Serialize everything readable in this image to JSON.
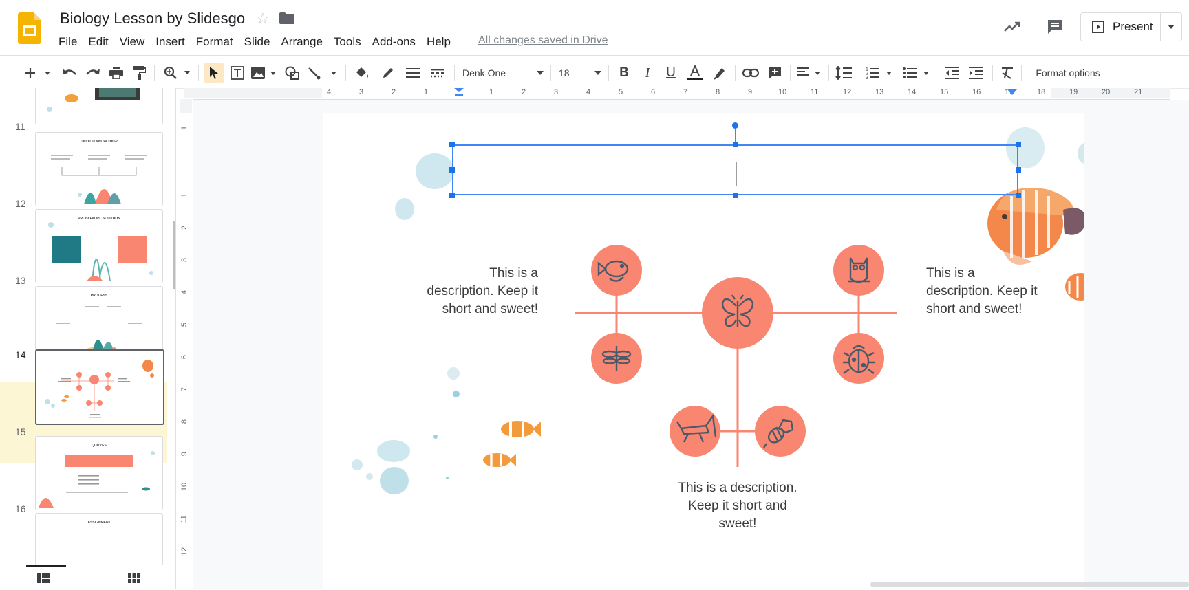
{
  "app": {
    "title": "Biology Lesson by Slidesgo",
    "save_status": "All changes saved in Drive",
    "menu": [
      "File",
      "Edit",
      "View",
      "Insert",
      "Format",
      "Slide",
      "Arrange",
      "Tools",
      "Add-ons",
      "Help"
    ],
    "present_label": "Present",
    "colors": {
      "accent": "#1a73e8",
      "logo": "#f4b400",
      "shape": "#f98670",
      "line": "#f98670",
      "selected_slide_bg": "#fdf6d5"
    }
  },
  "toolbar": {
    "font": "Denk One",
    "font_size": "18",
    "format_options": "Format options",
    "icons": [
      "new-slide-icon",
      "undo-icon",
      "redo-icon",
      "print-icon",
      "paint-format-icon",
      "zoom-icon",
      "select-icon",
      "text-box-icon",
      "image-icon",
      "shape-icon",
      "line-icon",
      "fill-color-icon",
      "border-color-icon",
      "border-weight-icon",
      "border-dash-icon",
      "bold-icon",
      "italic-icon",
      "underline-icon",
      "text-color-icon",
      "highlight-icon",
      "link-icon",
      "comment-icon",
      "align-icon",
      "line-spacing-icon",
      "numbered-list-icon",
      "bulleted-list-icon",
      "decrease-indent-icon",
      "increase-indent-icon",
      "clear-formatting-icon"
    ]
  },
  "filmstrip": {
    "slides": [
      {
        "number": "11",
        "title": "DID YOU KNOW THIS?"
      },
      {
        "number": "12",
        "title": "PROBLEM VS. SOLUTION"
      },
      {
        "number": "13",
        "title": "PROCESS"
      },
      {
        "number": "14",
        "title": ""
      },
      {
        "number": "15",
        "title": "QUIZZES"
      },
      {
        "number": "16",
        "title": "ASSIGNMENT"
      }
    ],
    "selected": "14"
  },
  "rulers": {
    "horizontal": [
      "4",
      "3",
      "2",
      "1",
      "1",
      "2",
      "3",
      "4",
      "5",
      "6",
      "7",
      "8",
      "9",
      "10",
      "11",
      "12",
      "13",
      "14",
      "15",
      "16",
      "17",
      "18",
      "19",
      "20",
      "21"
    ],
    "vertical": [
      "1",
      "1",
      "2",
      "3",
      "4",
      "5",
      "6",
      "7",
      "8",
      "9",
      "10",
      "11",
      "12"
    ]
  },
  "slide": {
    "descriptions": [
      "This is a description. Keep it short and sweet!",
      "This is a description. Keep it short and sweet!",
      "This is a description. Keep it short and sweet!"
    ],
    "nodes": [
      "fish-icon",
      "owl-icon",
      "butterfly-icon",
      "dragonfly-icon",
      "ladybug-icon",
      "grasshopper-icon",
      "bee-icon"
    ]
  }
}
